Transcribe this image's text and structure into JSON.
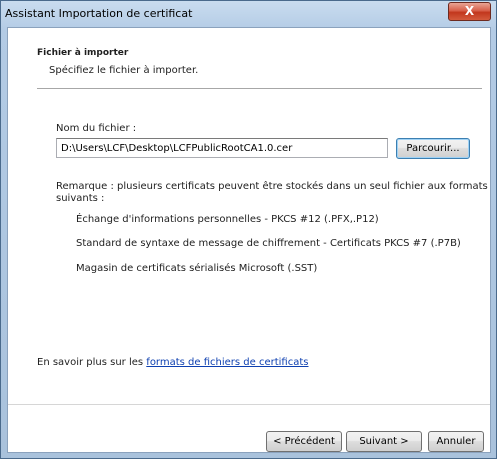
{
  "window": {
    "title": "Assistant Importation de certificat",
    "close_label": "X"
  },
  "header": {
    "title": "Fichier à importer",
    "subtitle": "Spécifiez le fichier à importer."
  },
  "file": {
    "label": "Nom du fichier :",
    "value": "D:\\Users\\LCF\\Desktop\\LCFPublicRootCA1.0.cer",
    "browse_label": "Parcourir..."
  },
  "note": {
    "line1": "Remarque : plusieurs certificats peuvent être stockés dans un seul fichier aux formats",
    "line2": "suivants :",
    "formats": [
      "Échange d'informations personnelles - PKCS #12 (.PFX,.P12)",
      "Standard de syntaxe de message de chiffrement - Certificats PKCS #7 (.P7B)",
      "Magasin de certificats sérialisés Microsoft (.SST)"
    ]
  },
  "learn_more": {
    "prefix": "En savoir plus sur les ",
    "link": "formats de fichiers de certificats"
  },
  "buttons": {
    "back": "< Précédent",
    "next": "Suivant >",
    "cancel": "Annuler"
  }
}
